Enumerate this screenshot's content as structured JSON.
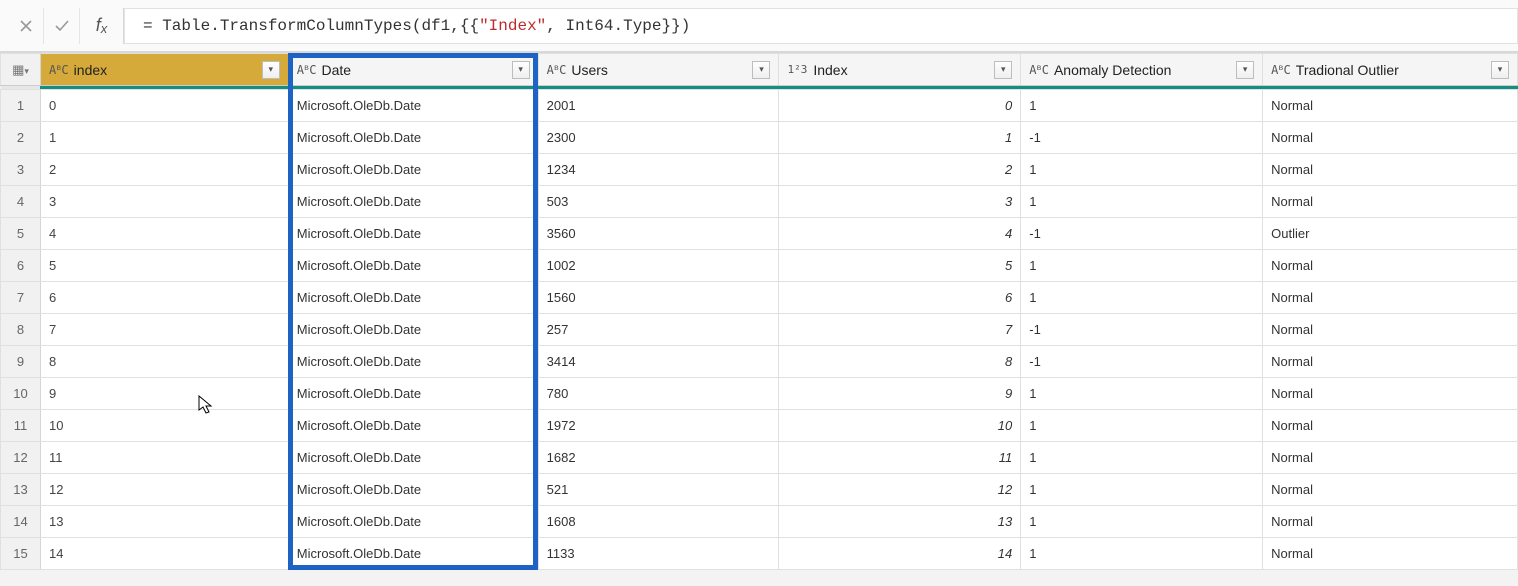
{
  "formula": {
    "prefix": "= Table.TransformColumnTypes(df1,{{",
    "string": "\"Index\"",
    "suffix": ", Int64.Type}})"
  },
  "header": {
    "cornerIcon": "▦",
    "typeIcons": {
      "text": "AᴮC",
      "number": "1²3"
    },
    "filterGlyph": "▾",
    "columns": [
      {
        "key": "index_str",
        "label": "index",
        "type": "text",
        "selected": true
      },
      {
        "key": "date",
        "label": "Date",
        "type": "text",
        "selected": false,
        "boxed": true
      },
      {
        "key": "users",
        "label": "Users",
        "type": "text",
        "selected": false
      },
      {
        "key": "index_num",
        "label": "Index",
        "type": "number",
        "selected": false
      },
      {
        "key": "anomaly",
        "label": "Anomaly Detection",
        "type": "text",
        "selected": false
      },
      {
        "key": "trad",
        "label": "Tradional Outlier",
        "type": "text",
        "selected": false
      }
    ]
  },
  "rows": [
    {
      "n": "1",
      "index_str": "0",
      "date": "Microsoft.OleDb.Date",
      "users": "2001",
      "index_num": "0",
      "anomaly": "1",
      "trad": "Normal"
    },
    {
      "n": "2",
      "index_str": "1",
      "date": "Microsoft.OleDb.Date",
      "users": "2300",
      "index_num": "1",
      "anomaly": "-1",
      "trad": "Normal"
    },
    {
      "n": "3",
      "index_str": "2",
      "date": "Microsoft.OleDb.Date",
      "users": "1234",
      "index_num": "2",
      "anomaly": "1",
      "trad": "Normal"
    },
    {
      "n": "4",
      "index_str": "3",
      "date": "Microsoft.OleDb.Date",
      "users": "503",
      "index_num": "3",
      "anomaly": "1",
      "trad": "Normal"
    },
    {
      "n": "5",
      "index_str": "4",
      "date": "Microsoft.OleDb.Date",
      "users": "3560",
      "index_num": "4",
      "anomaly": "-1",
      "trad": "Outlier"
    },
    {
      "n": "6",
      "index_str": "5",
      "date": "Microsoft.OleDb.Date",
      "users": "1002",
      "index_num": "5",
      "anomaly": "1",
      "trad": "Normal"
    },
    {
      "n": "7",
      "index_str": "6",
      "date": "Microsoft.OleDb.Date",
      "users": "1560",
      "index_num": "6",
      "anomaly": "1",
      "trad": "Normal"
    },
    {
      "n": "8",
      "index_str": "7",
      "date": "Microsoft.OleDb.Date",
      "users": "257",
      "index_num": "7",
      "anomaly": "-1",
      "trad": "Normal"
    },
    {
      "n": "9",
      "index_str": "8",
      "date": "Microsoft.OleDb.Date",
      "users": "3414",
      "index_num": "8",
      "anomaly": "-1",
      "trad": "Normal"
    },
    {
      "n": "10",
      "index_str": "9",
      "date": "Microsoft.OleDb.Date",
      "users": "780",
      "index_num": "9",
      "anomaly": "1",
      "trad": "Normal"
    },
    {
      "n": "11",
      "index_str": "10",
      "date": "Microsoft.OleDb.Date",
      "users": "1972",
      "index_num": "10",
      "anomaly": "1",
      "trad": "Normal"
    },
    {
      "n": "12",
      "index_str": "11",
      "date": "Microsoft.OleDb.Date",
      "users": "1682",
      "index_num": "11",
      "anomaly": "1",
      "trad": "Normal"
    },
    {
      "n": "13",
      "index_str": "12",
      "date": "Microsoft.OleDb.Date",
      "users": "521",
      "index_num": "12",
      "anomaly": "1",
      "trad": "Normal"
    },
    {
      "n": "14",
      "index_str": "13",
      "date": "Microsoft.OleDb.Date",
      "users": "1608",
      "index_num": "13",
      "anomaly": "1",
      "trad": "Normal"
    },
    {
      "n": "15",
      "index_str": "14",
      "date": "Microsoft.OleDb.Date",
      "users": "1133",
      "index_num": "14",
      "anomaly": "1",
      "trad": "Normal"
    }
  ]
}
